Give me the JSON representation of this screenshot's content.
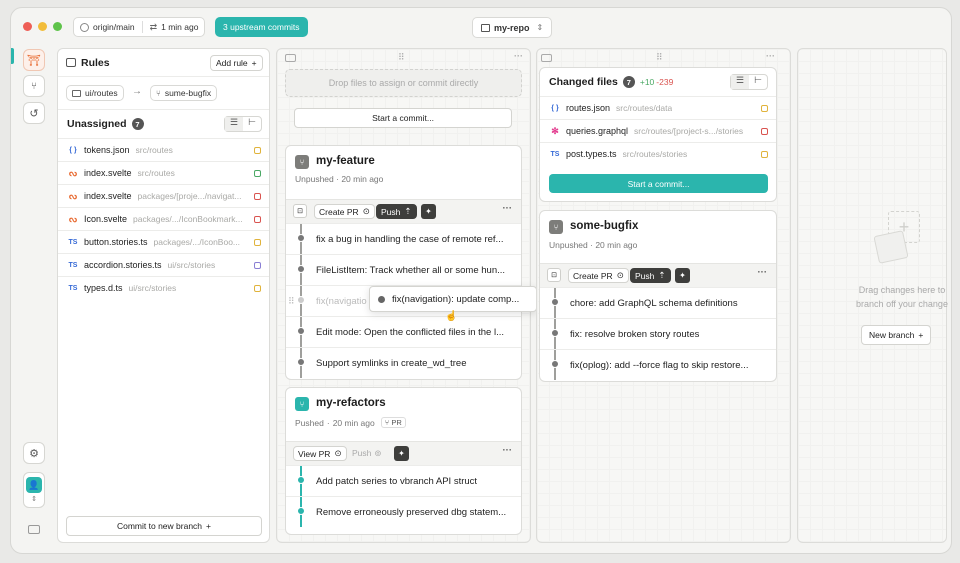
{
  "header": {
    "origin_branch": "origin/main",
    "last_fetch": "1 min ago",
    "upstream_badge": "3 upstream commits",
    "repo": "my-repo"
  },
  "rules_panel": {
    "title": "Rules",
    "add_rule": "Add rule",
    "rule_from": "ui/routes",
    "rule_to": "sume-bugfix",
    "unassigned_title": "Unassigned",
    "unassigned_count": "7",
    "files": [
      {
        "icon": "{ }",
        "name": "tokens.json",
        "path": "src/routes",
        "color": "#3569d6",
        "status": "#e0b33b"
      },
      {
        "icon": "svelte",
        "name": "index.svelte",
        "path": "src/routes",
        "color": "#e8692f",
        "status": "#4aa864"
      },
      {
        "icon": "svelte",
        "name": "index.svelte",
        "path": "packages/[proje.../navigat...",
        "color": "#e8692f",
        "status": "#d9534f"
      },
      {
        "icon": "svelte",
        "name": "Icon.svelte",
        "path": "packages/.../IconBookmark...",
        "color": "#e8692f",
        "status": "#d9534f"
      },
      {
        "icon": "TS",
        "name": "button.stories.ts",
        "path": "packages/.../IconBoo...",
        "color": "#3569d6",
        "status": "#e0b33b"
      },
      {
        "icon": "TS",
        "name": "accordion.stories.ts",
        "path": "ui/src/stories",
        "color": "#3569d6",
        "status": "#8a7fd4"
      },
      {
        "icon": "TS",
        "name": "types.d.ts",
        "path": "ui/src/stories",
        "color": "#3569d6",
        "status": "#e0b33b"
      }
    ],
    "commit_new_branch": "Commit to new branch"
  },
  "lane1": {
    "dropzone": "Drop files to assign or commit directly",
    "start_commit": "Start a commit...",
    "branch1": {
      "name": "my-feature",
      "status": "Unpushed",
      "time": "20 min ago",
      "create_pr": "Create PR",
      "push": "Push",
      "commits": [
        "fix a bug in handling the case of remote ref...",
        "FileListItem: Track whether all or some hun...",
        "fix(navigation): update comp...",
        "Edit mode: Open the conflicted files in the l...",
        "Support symlinks in create_wd_tree"
      ],
      "ghost_commit": "fix(navigatio",
      "drag_commit": "fix(navigation): update comp..."
    },
    "branch2": {
      "name": "my-refactors",
      "status": "Pushed",
      "time": "20 min ago",
      "pr_badge": "PR",
      "view_pr": "View PR",
      "push": "Push",
      "commits": [
        "Add patch series to vbranch API struct",
        "Remove erroneously preserved dbg statem..."
      ]
    }
  },
  "lane2": {
    "changed_title": "Changed files",
    "changed_count": "7",
    "additions": "+10",
    "deletions": "-239",
    "files": [
      {
        "icon": "{ }",
        "name": "routes.json",
        "path": "src/routes/data",
        "color": "#3569d6",
        "status": "#e0b33b"
      },
      {
        "icon": "gql",
        "name": "queries.graphql",
        "path": "src/routes/[project-s.../stories",
        "color": "#e33d8f",
        "status": "#d9534f"
      },
      {
        "icon": "TS",
        "name": "post.types.ts",
        "path": "src/routes/stories",
        "color": "#3569d6",
        "status": "#e0b33b"
      }
    ],
    "start_commit": "Start a commit...",
    "branch": {
      "name": "some-bugfix",
      "status": "Unpushed",
      "time": "20 min ago",
      "create_pr": "Create PR",
      "push": "Push",
      "commits": [
        "chore: add GraphQL schema definitions",
        "fix: resolve broken story routes",
        "fix(oplog): add --force flag to skip restore..."
      ]
    }
  },
  "empty_lane": {
    "hint_line1": "Drag changes here to",
    "hint_line2": "branch off your change",
    "new_branch": "New branch"
  },
  "colors": {
    "accent": "#2bb5ad",
    "brand_gray": "#7d7d7a"
  }
}
